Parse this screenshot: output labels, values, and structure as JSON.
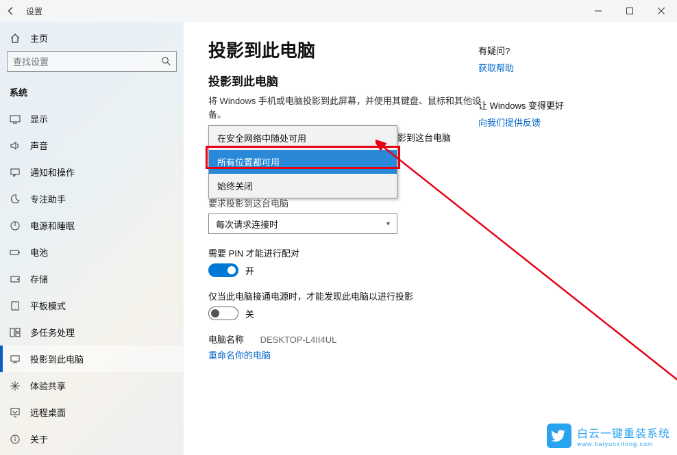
{
  "titlebar": {
    "title": "设置"
  },
  "sidebar": {
    "home": "主页",
    "search_placeholder": "查找设置",
    "section": "系统",
    "items": [
      {
        "label": "显示"
      },
      {
        "label": "声音"
      },
      {
        "label": "通知和操作"
      },
      {
        "label": "专注助手"
      },
      {
        "label": "电源和睡眠"
      },
      {
        "label": "电池"
      },
      {
        "label": "存储"
      },
      {
        "label": "平板模式"
      },
      {
        "label": "多任务处理"
      },
      {
        "label": "投影到此电脑"
      },
      {
        "label": "体验共享"
      },
      {
        "label": "远程桌面"
      },
      {
        "label": "关于"
      }
    ]
  },
  "main": {
    "page_title": "投影到此电脑",
    "sub_title": "投影到此电脑",
    "desc": "将 Windows 手机或电脑投影到此屏幕，并使用其键盘、鼠标和其他设备。",
    "truncated_label": "影到这台电脑",
    "dropdown_options": [
      "在安全网络中随处可用",
      "所有位置都可用",
      "始终关闭"
    ],
    "ask_label": "要求投影到这台电脑",
    "ask_select": "每次请求连接时",
    "pin_label": "需要 PIN 才能进行配对",
    "pin_state": "开",
    "power_label": "仅当此电脑接通电源时，才能发现此电脑以进行投影",
    "power_state": "关",
    "pc_name_label": "电脑名称",
    "pc_name_value": "DESKTOP-L4II4UL",
    "rename_link": "重命名你的电脑"
  },
  "right_panel": {
    "q_title": "有疑问?",
    "q_link": "获取帮助",
    "fb_title": "让 Windows 变得更好",
    "fb_link": "向我们提供反馈"
  },
  "watermark": {
    "text": "白云一键重装系统",
    "url": "www.baiyunxitong.com"
  }
}
